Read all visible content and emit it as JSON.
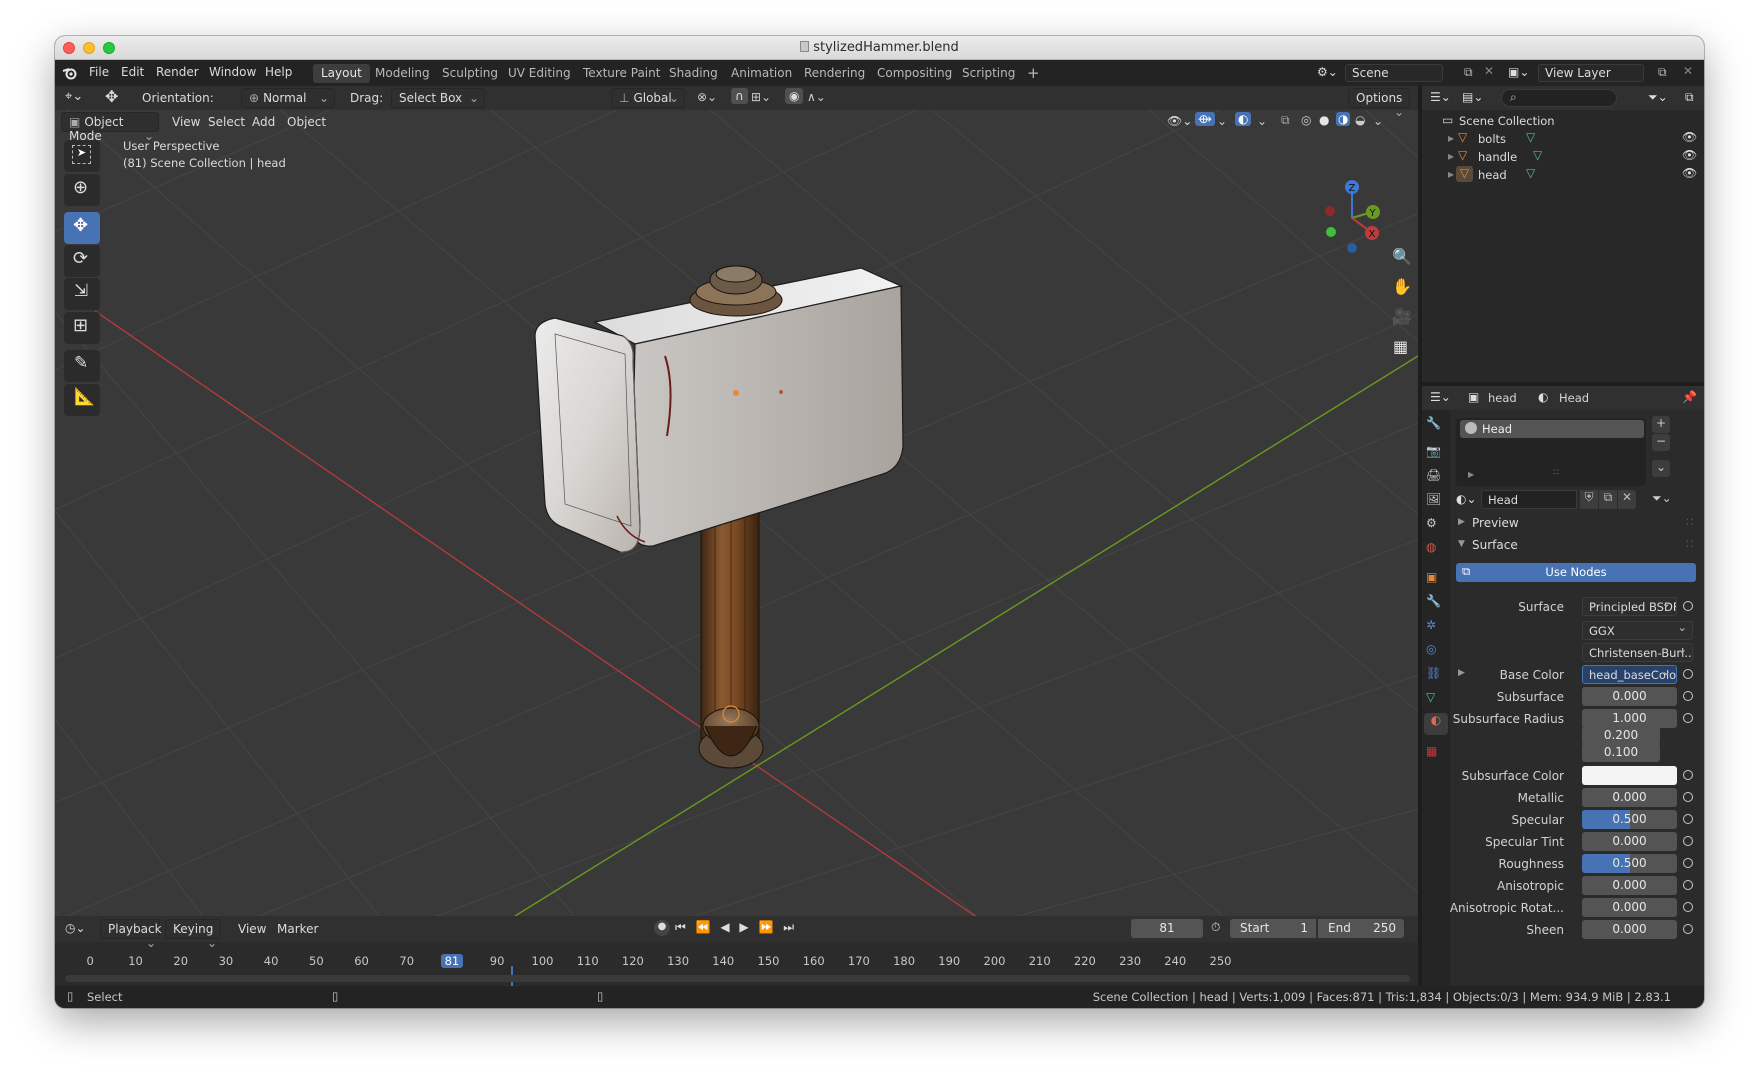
{
  "window": {
    "title": "stylizedHammer.blend"
  },
  "menu": [
    "File",
    "Edit",
    "Render",
    "Window",
    "Help"
  ],
  "workspaces": [
    "Layout",
    "Modeling",
    "Sculpting",
    "UV Editing",
    "Texture Paint",
    "Shading",
    "Animation",
    "Rendering",
    "Compositing",
    "Scripting"
  ],
  "scene": {
    "name": "Scene",
    "view_layer": "View Layer"
  },
  "tool_header": {
    "orientation_label": "Orientation:",
    "orientation_value": "Normal",
    "drag_label": "Drag:",
    "drag_value": "Select Box",
    "transform_space": "Global",
    "options": "Options"
  },
  "viewport_header": {
    "mode": "Object Mode",
    "menus": [
      "View",
      "Select",
      "Add",
      "Object"
    ]
  },
  "viewport": {
    "perspective": "User Perspective",
    "context": "(81) Scene Collection | head",
    "gizmo": {
      "z": "Z",
      "y": "Y",
      "x": "X"
    }
  },
  "outliner": {
    "search_placeholder": "",
    "root": "Scene Collection",
    "items": [
      {
        "name": "bolts"
      },
      {
        "name": "handle"
      },
      {
        "name": "head"
      }
    ]
  },
  "properties": {
    "object_name": "head",
    "material_name": "Head",
    "slot": "Head",
    "material_field": "Head",
    "panels": {
      "preview": "Preview",
      "surface": "Surface"
    },
    "use_nodes": "Use Nodes",
    "surface_label": "Surface",
    "surface_value": "Principled BSDF",
    "distribution": "GGX",
    "subsurface_method": "Christensen-Burl...",
    "fields": [
      {
        "label": "Base Color",
        "value": "head_baseColo...",
        "kind": "texture"
      },
      {
        "label": "Subsurface",
        "value": "0.000",
        "fill": 0
      },
      {
        "label": "Subsurface Radius",
        "value": "1.000",
        "fill": 0
      },
      {
        "label": "",
        "value": "0.200",
        "fill": 0
      },
      {
        "label": "",
        "value": "0.100",
        "fill": 0
      },
      {
        "label": "Subsurface Color",
        "value": "",
        "kind": "color"
      },
      {
        "label": "Metallic",
        "value": "0.000",
        "fill": 0
      },
      {
        "label": "Specular",
        "value": "0.500",
        "fill": 0.5
      },
      {
        "label": "Specular Tint",
        "value": "0.000",
        "fill": 0
      },
      {
        "label": "Roughness",
        "value": "0.500",
        "fill": 0.5
      },
      {
        "label": "Anisotropic",
        "value": "0.000",
        "fill": 0
      },
      {
        "label": "Anisotropic Rotat...",
        "value": "0.000",
        "fill": 0
      },
      {
        "label": "Sheen",
        "value": "0.000",
        "fill": 0
      }
    ]
  },
  "timeline": {
    "menus": [
      "Playback",
      "Keying",
      "View",
      "Marker"
    ],
    "current_frame": "81",
    "start_label": "Start",
    "start": "1",
    "end_label": "End",
    "end": "250",
    "ruler": [
      "0",
      "10",
      "20",
      "30",
      "40",
      "50",
      "60",
      "70",
      "81",
      "90",
      "100",
      "110",
      "120",
      "130",
      "140",
      "150",
      "160",
      "170",
      "180",
      "190",
      "200",
      "210",
      "220",
      "230",
      "240",
      "250"
    ]
  },
  "status": {
    "left": "Select",
    "right": "Scene Collection | head | Verts:1,009 | Faces:871 | Tris:1,834 | Objects:0/3 | Mem: 934.9 MiB | 2.83.1"
  },
  "colors": {
    "accent": "#4772b3",
    "orange": "#e68a3a",
    "green_axis": "#6a9a1f",
    "red_axis": "#b33a3a"
  }
}
